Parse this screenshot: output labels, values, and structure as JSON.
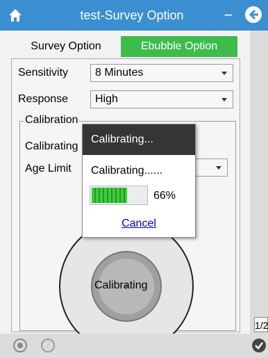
{
  "window": {
    "title": "test-Survey Option",
    "icons": [
      "home-icon",
      "minimize-icon",
      "back-arrow-icon"
    ]
  },
  "tabs": [
    {
      "label": "Survey Option",
      "active": false
    },
    {
      "label": "Ebubble Option",
      "active": true,
      "color": "#3dbb4b"
    }
  ],
  "form": {
    "sensitivity": {
      "label": "Sensitivity",
      "value": "8 Minutes"
    },
    "response": {
      "label": "Response",
      "value": "High"
    },
    "calibration_group": "Calibration",
    "calibrating_label": "Calibrating",
    "age_limit_label": "Age Limit"
  },
  "bubble": {
    "label": "Calibrating"
  },
  "dialog": {
    "title": "Calibrating...",
    "message": "Calibrating......",
    "progress_percent": 66,
    "progress_text": "66%",
    "cancel_label": "Cancel"
  },
  "pager": {
    "text": "1/2"
  },
  "bottombar": {
    "icons": [
      "target-icon",
      "compass-icon",
      "checkmark-circle-icon"
    ]
  },
  "colors": {
    "accent": "#3b8ed0",
    "tab_active": "#3dbb4b",
    "progress": "#3dcc3d"
  }
}
